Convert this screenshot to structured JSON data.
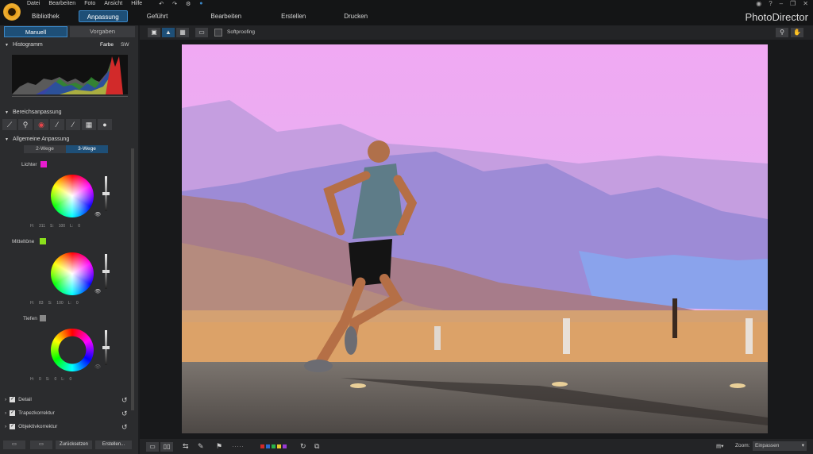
{
  "app": {
    "brand": "PhotoDirector"
  },
  "menu": [
    "Datei",
    "Bearbeiten",
    "Foto",
    "Ansicht",
    "Hilfe"
  ],
  "modes": [
    {
      "label": "Bibliothek",
      "active": false
    },
    {
      "label": "Anpassung",
      "active": true
    },
    {
      "label": "Geführt",
      "active": false
    },
    {
      "label": "Bearbeiten",
      "active": false
    },
    {
      "label": "Erstellen",
      "active": false
    },
    {
      "label": "Drucken",
      "active": false
    }
  ],
  "window_controls": [
    "?",
    "–",
    "❐",
    "✕"
  ],
  "panel": {
    "tabs": {
      "manual": "Manuell",
      "presets": "Vorgaben"
    },
    "histogram": {
      "title": "Histogramm",
      "color": "Farbe",
      "sw": "SW"
    },
    "regional": {
      "title": "Bereichsanpassung",
      "tools": [
        "crop-tool",
        "redeye-tool",
        "eye-tool",
        "brush-tool",
        "gradient-tool",
        "square-tool",
        "circle-tool"
      ]
    },
    "general": {
      "title": "Allgemeine Anpassung",
      "two_way": "2-Wege",
      "three_way": "3-Wege"
    },
    "lights": {
      "label": "Lichter",
      "swatch": "#e81ccf",
      "h": "H:",
      "h_val": "311",
      "s": "S:",
      "s_val": "100",
      "l": "L:",
      "l_val": "0"
    },
    "mids": {
      "label": "Mitteltöne",
      "swatch": "#8be01c",
      "h": "H:",
      "h_val": "83",
      "s": "S:",
      "s_val": "100",
      "l": "L:",
      "l_val": "0"
    },
    "shadows": {
      "label": "Tiefen",
      "swatch": "#888888",
      "h": "H:",
      "h_val": "0",
      "s": "S:",
      "s_val": "0",
      "l": "L:",
      "l_val": "0"
    },
    "collapsed": [
      "Detail",
      "Trapezkorrektur",
      "Objektivkorrektur"
    ],
    "bottom": {
      "reset": "Zurücksetzen",
      "create": "Erstellen..."
    }
  },
  "toolbar": {
    "softproofing": "Softproofing"
  },
  "statusbar": {
    "zoom_label": "Zoom:",
    "zoom_value": "Einpassen"
  },
  "colors": {
    "accent": "#3b88c8",
    "sky": "#e9a2f0"
  }
}
